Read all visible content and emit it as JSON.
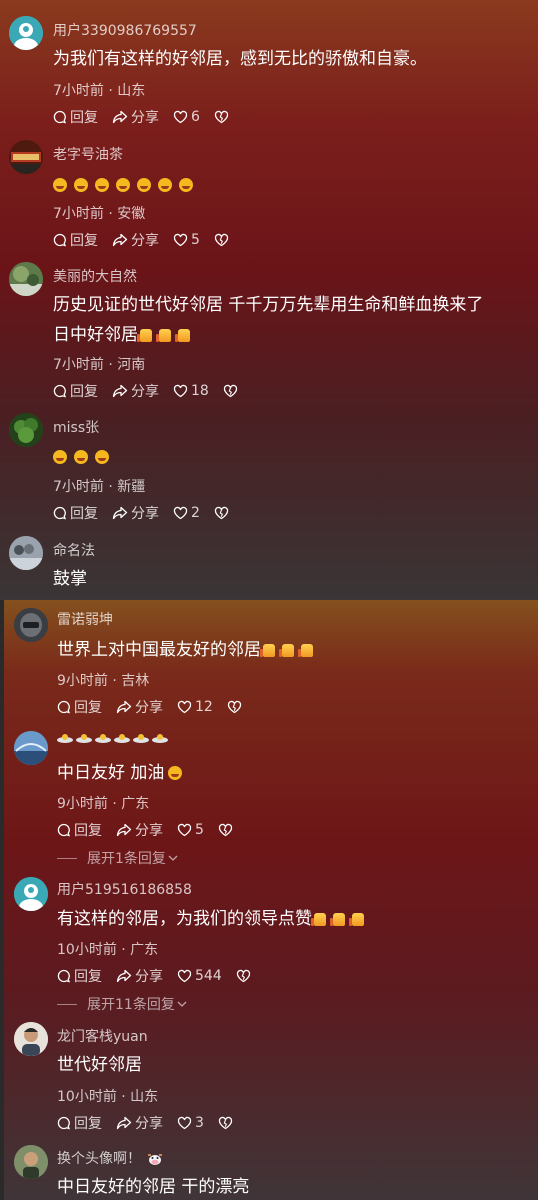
{
  "panel1": {
    "comments": [
      {
        "user": "用户3390986769557",
        "text": "为我们有这样的好邻居，感到无比的骄傲和自豪。",
        "meta": "7小时前 · 山东",
        "reply": "回复",
        "share": "分享",
        "likes": "6"
      },
      {
        "user": "老字号油茶",
        "text": "",
        "meta": "7小时前 · 安徽",
        "reply": "回复",
        "share": "分享",
        "likes": "5"
      },
      {
        "user": "美丽的大自然",
        "text": "历史见证的世代好邻居  千千万万先辈用生命和鲜血换来了",
        "text2": "日中好邻居",
        "meta": "7小时前 · 河南",
        "reply": "回复",
        "share": "分享",
        "likes": "18"
      },
      {
        "user": "miss张",
        "text": "",
        "meta": "7小时前 · 新疆",
        "reply": "回复",
        "share": "分享",
        "likes": "2"
      },
      {
        "user": "命名法",
        "text": "鼓掌"
      }
    ]
  },
  "panel2": {
    "comments": [
      {
        "user": "雷诺弱坤",
        "text": "世界上对中国最友好的邻居",
        "meta": "9小时前 · 吉林",
        "reply": "回复",
        "share": "分享",
        "likes": "12"
      },
      {
        "user": "",
        "text": "中日友好  加油",
        "meta": "9小时前 · 广东",
        "reply": "回复",
        "share": "分享",
        "likes": "5",
        "expand": "展开1条回复"
      },
      {
        "user": "用户519516186858",
        "text": "有这样的邻居，为我们的领导点赞",
        "meta": "10小时前 · 广东",
        "reply": "回复",
        "share": "分享",
        "likes": "544",
        "expand": "展开11条回复"
      },
      {
        "user": "龙门客栈yuan",
        "text": "世代好邻居",
        "meta": "10小时前 · 山东",
        "reply": "回复",
        "share": "分享",
        "likes": "3"
      },
      {
        "user": "换个头像啊！",
        "text": "中日友好的邻居 干的漂亮"
      }
    ]
  },
  "colors": {
    "accent_avatar": "#39a9b4",
    "like_heart": "#ffffff"
  }
}
